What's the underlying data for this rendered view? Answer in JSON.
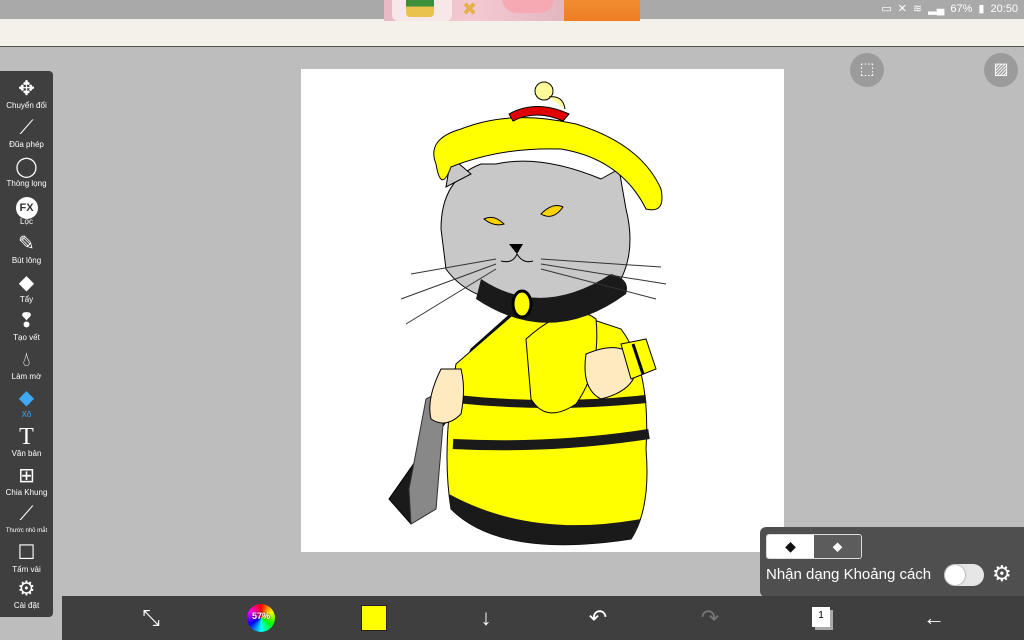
{
  "status_bar": {
    "battery": "67%",
    "time": "20:50",
    "icons": [
      "cast-icon",
      "mute-icon",
      "wifi-icon",
      "signal-icon",
      "battery-icon"
    ]
  },
  "toolbar": {
    "tools": [
      {
        "label": "Chuyển đổi",
        "icon": "move-icon"
      },
      {
        "label": "Đũa phép",
        "icon": "magic-wand-icon"
      },
      {
        "label": "Thòng lọng",
        "icon": "lasso-icon"
      },
      {
        "label": "Lọc",
        "icon": "fx-filter-icon"
      },
      {
        "label": "Bút lông",
        "icon": "brush-icon"
      },
      {
        "label": "Tẩy",
        "icon": "eraser-icon"
      },
      {
        "label": "Tạo vết",
        "icon": "smudge-icon"
      },
      {
        "label": "Làm mờ",
        "icon": "blur-drop-icon"
      },
      {
        "label": "Xô",
        "icon": "bucket-icon"
      },
      {
        "label": "Văn bản",
        "icon": "text-icon"
      },
      {
        "label": "Chia Khung",
        "icon": "frame-divider-icon"
      },
      {
        "label": "Thước nhỏ mắt",
        "icon": "eyedropper-icon"
      },
      {
        "label": "Tấm vải",
        "icon": "canvas-icon"
      },
      {
        "label": "Cài đặt",
        "icon": "settings-gear-icon"
      }
    ],
    "active_tool": "Xô",
    "fx_text": "FX"
  },
  "fill_panel": {
    "modes": [
      "fill-icon",
      "eraser-icon"
    ],
    "active_mode": "fill-icon",
    "gap_detection_label": "Nhận dạng Khoảng cách",
    "gap_detection_on": false
  },
  "bottom_bar": {
    "brush_size_percent": "57%",
    "current_color": "#ffff00",
    "layer_count": "1",
    "icons": [
      "transform-icon",
      "color-wheel-icon",
      "color-swatch-icon",
      "download-icon",
      "undo-icon",
      "redo-icon",
      "layers-icon",
      "back-arrow-icon"
    ]
  },
  "colors": {
    "toolbar_bg": "#3f3f3f",
    "active": "#3fa9f5",
    "workspace": "#bdbdbd",
    "canvas": "#ffffff"
  }
}
